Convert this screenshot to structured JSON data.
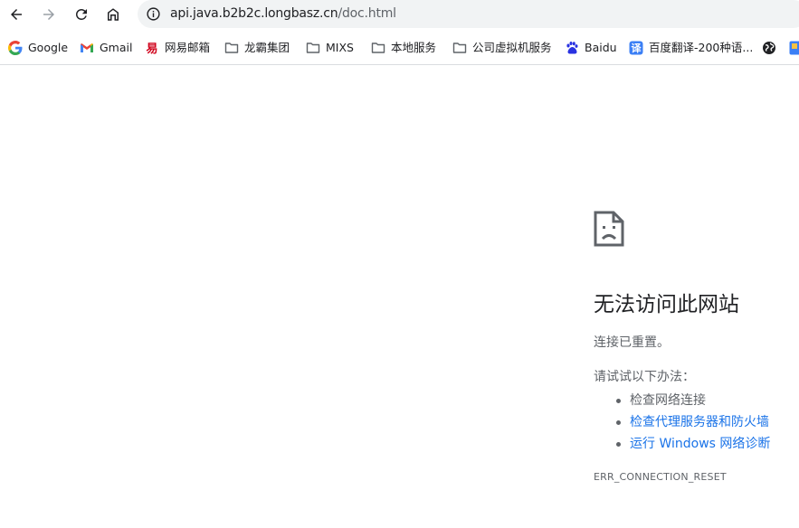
{
  "browser": {
    "url_host": "api.java.b2b2c.longbasz.cn",
    "url_path": "/doc.html"
  },
  "bookmarks": [
    {
      "label": "Google",
      "icon": "google-icon"
    },
    {
      "label": "Gmail",
      "icon": "gmail-icon"
    },
    {
      "label": "网易邮箱",
      "icon": "netease-mail-icon"
    },
    {
      "label": "龙霸集团",
      "icon": "folder-icon"
    },
    {
      "label": "MIXS",
      "icon": "folder-icon"
    },
    {
      "label": "本地服务",
      "icon": "folder-icon"
    },
    {
      "label": "公司虚拟机服务",
      "icon": "folder-icon"
    },
    {
      "label": "Baidu",
      "icon": "baidu-paw-icon"
    },
    {
      "label": "百度翻译-200种语...",
      "icon": "baidu-translate-icon"
    },
    {
      "label": "",
      "icon": "globe-icon"
    },
    {
      "label": "",
      "icon": "partial-bookmark-icon"
    }
  ],
  "error": {
    "title": "无法访问此网站",
    "detail": "连接已重置。",
    "suggestions_heading": "请试试以下办法：",
    "suggestions": [
      {
        "text": "检查网络连接",
        "link": false
      },
      {
        "text": "检查代理服务器和防火墙",
        "link": true
      },
      {
        "text": "运行 Windows 网络诊断",
        "link": true
      }
    ],
    "code": "ERR_CONNECTION_RESET"
  },
  "colors": {
    "link": "#1a73e8",
    "text": "#202124",
    "secondary_text": "#5f6368",
    "omnibox_bg": "#f1f3f4"
  }
}
